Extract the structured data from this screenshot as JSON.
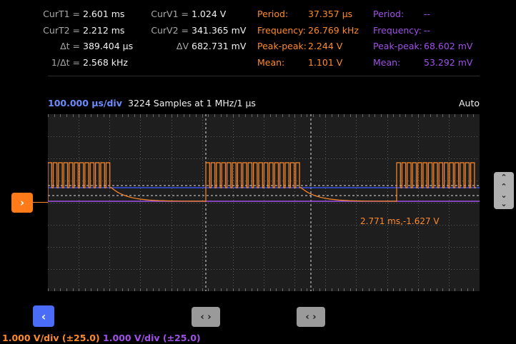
{
  "cursors": {
    "curt1": {
      "label": "CurT1 =",
      "value": "2.601 ms"
    },
    "curt2": {
      "label": "CurT2 =",
      "value": "2.212 ms"
    },
    "dt": {
      "label": "Δt =",
      "value": "389.404 µs"
    },
    "inv_dt": {
      "label": "1/Δt =",
      "value": "2.568 kHz"
    },
    "curv1": {
      "label": "CurV1 =",
      "value": "1.024 V"
    },
    "curv2": {
      "label": "CurV2 =",
      "value": "341.365 mV"
    },
    "dv": {
      "label": "ΔV",
      "value": "682.731 mV"
    }
  },
  "ch1_meas": [
    {
      "label": "Period:",
      "value": "37.357 µs"
    },
    {
      "label": "Frequency:",
      "value": "26.769 kHz"
    },
    {
      "label": "Peak-peak:",
      "value": "2.244 V"
    },
    {
      "label": "Mean:",
      "value": "1.101 V"
    }
  ],
  "ch2_meas": [
    {
      "label": "Period:",
      "value": "--"
    },
    {
      "label": "Frequency:",
      "value": "--"
    },
    {
      "label": "Peak-peak:",
      "value": "68.602 mV"
    },
    {
      "label": "Mean:",
      "value": "53.292 mV"
    }
  ],
  "timebase": "100.000 µs/div",
  "samples": "3224 Samples at 1 MHz/1 µs",
  "trigger_mode": "Auto",
  "cursor_readout": "2.771 ms,-1.627 V",
  "ch1_scale": "1.000 V/div (±25.0)",
  "ch2_scale": "1.000 V/div (±25.0)",
  "colors": {
    "ch1": "#ff8a2a",
    "ch2": "#a050e8",
    "accent": "#4a6cf7",
    "timebase": "#6a8cff"
  },
  "icons": {
    "marker": "chevron-right-icon",
    "back": "chevron-left-icon",
    "cursor_handle": "left-right-arrows-icon",
    "scroll": "up-down-chevrons-icon"
  }
}
